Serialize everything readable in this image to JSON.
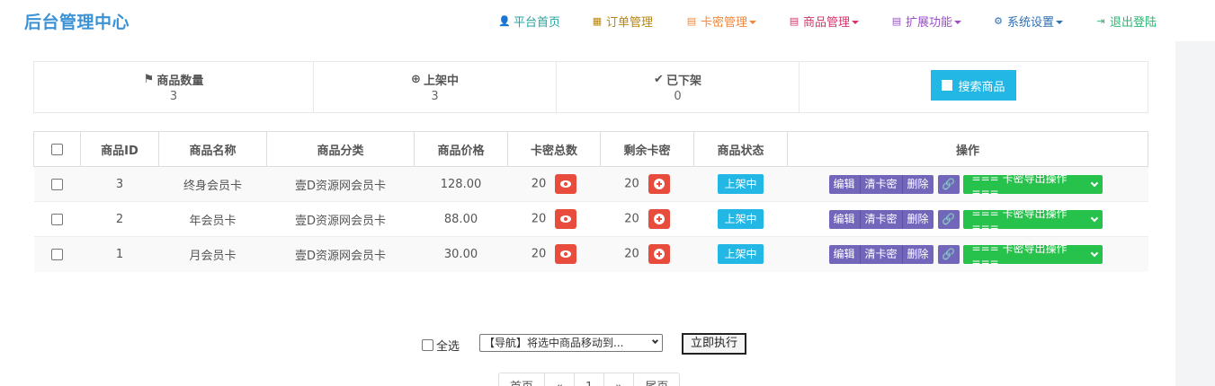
{
  "brand": "后台管理中心",
  "nav": [
    {
      "label": "平台首页",
      "color": "#27a3a0",
      "icon": "user-icon",
      "dropdown": false
    },
    {
      "label": "订单管理",
      "color": "#b8860b",
      "icon": "calendar-icon",
      "dropdown": false
    },
    {
      "label": "卡密管理",
      "color": "#f0883e",
      "icon": "list-icon",
      "dropdown": true
    },
    {
      "label": "商品管理",
      "color": "#d6336c",
      "icon": "list-icon",
      "dropdown": true
    },
    {
      "label": "扩展功能",
      "color": "#9b4dca",
      "icon": "list-icon",
      "dropdown": true
    },
    {
      "label": "系统设置",
      "color": "#2f6fb5",
      "icon": "gear-icon",
      "dropdown": true
    },
    {
      "label": "退出登陆",
      "color": "#2bb673",
      "icon": "logout-icon",
      "dropdown": false
    }
  ],
  "stats": [
    {
      "label": "商品数量",
      "value": "3",
      "icon": "flag-icon"
    },
    {
      "label": "上架中",
      "value": "3",
      "icon": "plus-circle-icon"
    },
    {
      "label": "已下架",
      "value": "0",
      "icon": "check-icon"
    }
  ],
  "search_label": "搜索商品",
  "table": {
    "headers": [
      "商品ID",
      "商品名称",
      "商品分类",
      "商品价格",
      "卡密总数",
      "剩余卡密",
      "商品状态",
      "操作"
    ],
    "rows": [
      {
        "id": "3",
        "name": "终身会员卡",
        "category": "壹D资源网会员卡",
        "price": "128.00",
        "total": "20",
        "remain": "20",
        "status": "上架中"
      },
      {
        "id": "2",
        "name": "年会员卡",
        "category": "壹D资源网会员卡",
        "price": "88.00",
        "total": "20",
        "remain": "20",
        "status": "上架中"
      },
      {
        "id": "1",
        "name": "月会员卡",
        "category": "壹D资源网会员卡",
        "price": "30.00",
        "total": "20",
        "remain": "20",
        "status": "上架中"
      }
    ],
    "ops": {
      "edit": "编辑",
      "clear": "清卡密",
      "delete": "删除",
      "export": "=== 卡密导出操作 ==="
    }
  },
  "bulk": {
    "select_all": "全选",
    "move_select": "【导航】将选中商品移动到...",
    "execute": "立即执行"
  },
  "pager": [
    "首页",
    "«",
    "1",
    "»",
    "尾页"
  ]
}
